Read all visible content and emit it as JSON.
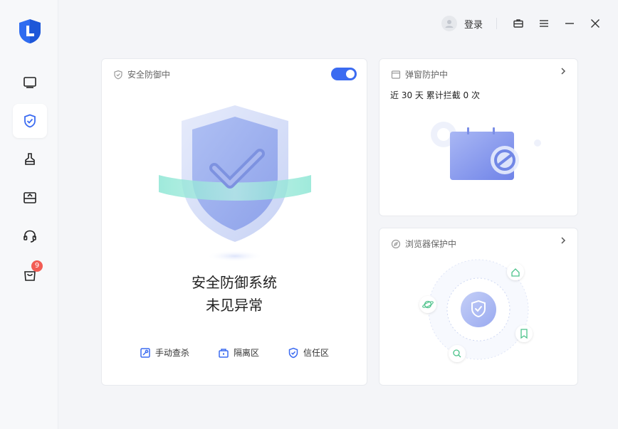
{
  "header": {
    "login_label": "登录"
  },
  "sidebar": {
    "badge_count": "9"
  },
  "defense_card": {
    "title": "安全防御中",
    "toggle_on": true,
    "status_line1": "安全防御系统",
    "status_line2": "未见异常",
    "actions": [
      {
        "label": "手动查杀",
        "icon": "wrench-scan-icon"
      },
      {
        "label": "隔离区",
        "icon": "quarantine-box-icon"
      },
      {
        "label": "信任区",
        "icon": "trust-shield-icon"
      }
    ]
  },
  "popup_card": {
    "title": "弹窗防护中",
    "stat": "近 30 天 累计拦截 0 次"
  },
  "browser_card": {
    "title": "浏览器保护中"
  },
  "colors": {
    "accent": "#3b6bf1",
    "badge": "#f25c54",
    "orbit_icon": "#4cc28a"
  }
}
